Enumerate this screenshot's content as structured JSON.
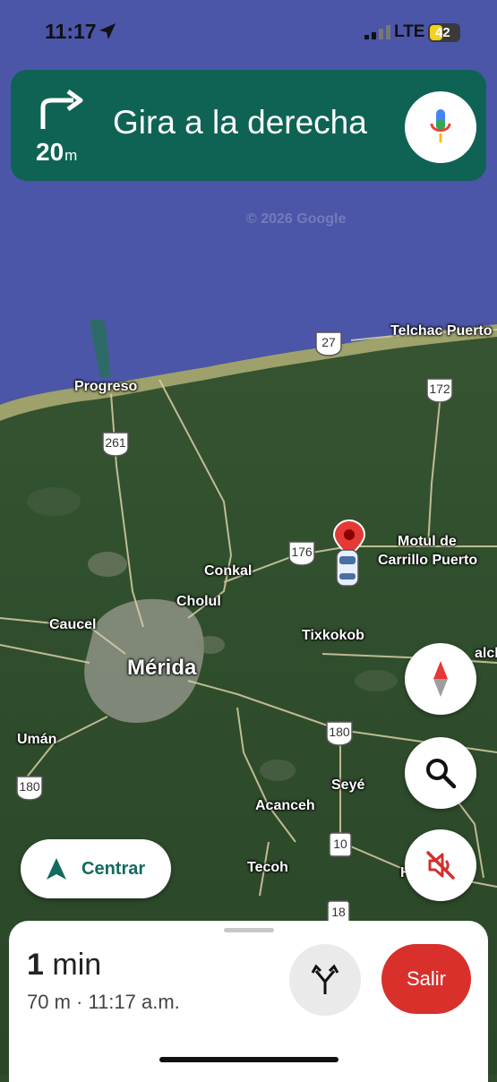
{
  "status": {
    "time": "11:17",
    "network": "LTE",
    "battery": "42"
  },
  "nav": {
    "instruction": "Gira a la derecha",
    "distance_value": "20",
    "distance_unit": "m"
  },
  "map": {
    "watermark": "© 2026 Google",
    "places": {
      "telchac": "Telchac Puerto",
      "progreso": "Progreso",
      "conkal": "Conkal",
      "cholul": "Cholul",
      "caucel": "Caucel",
      "merida": "Mérida",
      "motul_1": "Motul de",
      "motul_2": "Carrillo Puerto",
      "tixkokob": "Tixkokob",
      "uman": "Umán",
      "seye": "Seyé",
      "acanceh": "Acanceh",
      "tecoh": "Tecoh",
      "cacalchen_partial": "alche",
      "hoctun_partial": "H"
    },
    "routes": {
      "r27": "27",
      "r172": "172",
      "r261": "261",
      "r176": "176",
      "r180a": "180",
      "r180b": "180",
      "r10": "10",
      "r18": "18",
      "r261b": "261"
    }
  },
  "controls": {
    "recenter_label": "Centrar"
  },
  "sheet": {
    "eta_value": "1",
    "eta_unit": "min",
    "details": "70 m · 11:17 a.m.",
    "exit_label": "Salir"
  },
  "colors": {
    "nav_green": "#0f6354",
    "exit_red": "#d9302c",
    "sea": "#4a58a8",
    "land": "#2f4a2c"
  }
}
